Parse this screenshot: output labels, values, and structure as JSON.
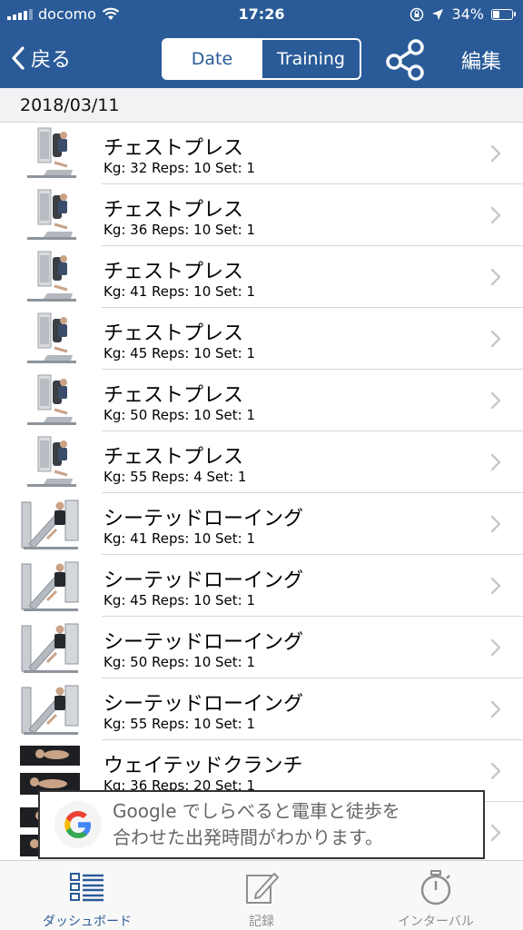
{
  "status_bar": {
    "carrier": "docomo",
    "time": "17:26",
    "battery_percent": "34%",
    "battery_level": 0.34,
    "icons": [
      "signal-icon",
      "wifi-icon",
      "rotation-lock-icon",
      "location-icon",
      "battery-icon"
    ]
  },
  "nav": {
    "back_label": "戻る",
    "segments": [
      "Date",
      "Training"
    ],
    "selected_segment": "Date",
    "share_icon": "share-icon",
    "edit_label": "編集"
  },
  "section": {
    "date": "2018/03/11"
  },
  "exercises": [
    {
      "name": "チェストプレス",
      "detail": "Kg: 32 Reps: 10 Set: 1",
      "image": "chest-press-machine"
    },
    {
      "name": "チェストプレス",
      "detail": "Kg: 36 Reps: 10 Set: 1",
      "image": "chest-press-machine"
    },
    {
      "name": "チェストプレス",
      "detail": "Kg: 41 Reps: 10 Set: 1",
      "image": "chest-press-machine"
    },
    {
      "name": "チェストプレス",
      "detail": "Kg: 45 Reps: 10 Set: 1",
      "image": "chest-press-machine"
    },
    {
      "name": "チェストプレス",
      "detail": "Kg: 50 Reps: 10 Set: 1",
      "image": "chest-press-machine"
    },
    {
      "name": "チェストプレス",
      "detail": "Kg: 55 Reps: 4 Set: 1",
      "image": "chest-press-machine"
    },
    {
      "name": "シーテッドローイング",
      "detail": "Kg: 41 Reps: 10 Set: 1",
      "image": "seated-row-machine"
    },
    {
      "name": "シーテッドローイング",
      "detail": "Kg: 45 Reps: 10 Set: 1",
      "image": "seated-row-machine"
    },
    {
      "name": "シーテッドローイング",
      "detail": "Kg: 50 Reps: 10 Set: 1",
      "image": "seated-row-machine"
    },
    {
      "name": "シーテッドローイング",
      "detail": "Kg: 55 Reps: 10 Set: 1",
      "image": "seated-row-machine"
    },
    {
      "name": "ウェイテッドクランチ",
      "detail": "Kg: 36 Reps: 20 Set: 1",
      "image": "crunch-mat"
    },
    {
      "name": "",
      "detail": "",
      "image": "crunch-mat"
    }
  ],
  "ad": {
    "line1": "Google でしらべると電車と徒歩を",
    "line2": "合わせた出発時間がわかります。",
    "logo": "google-g-logo"
  },
  "tabbar": {
    "tabs": [
      {
        "label": "ダッシュボード",
        "icon": "dashboard-icon",
        "active": true
      },
      {
        "label": "記録",
        "icon": "record-edit-icon",
        "active": false
      },
      {
        "label": "インターバル",
        "icon": "stopwatch-icon",
        "active": false
      }
    ]
  },
  "colors": {
    "header": "#2a5b98",
    "accent": "#2a5b98",
    "tab_inactive": "#8e8e93",
    "chevron": "#c7c7cc"
  }
}
